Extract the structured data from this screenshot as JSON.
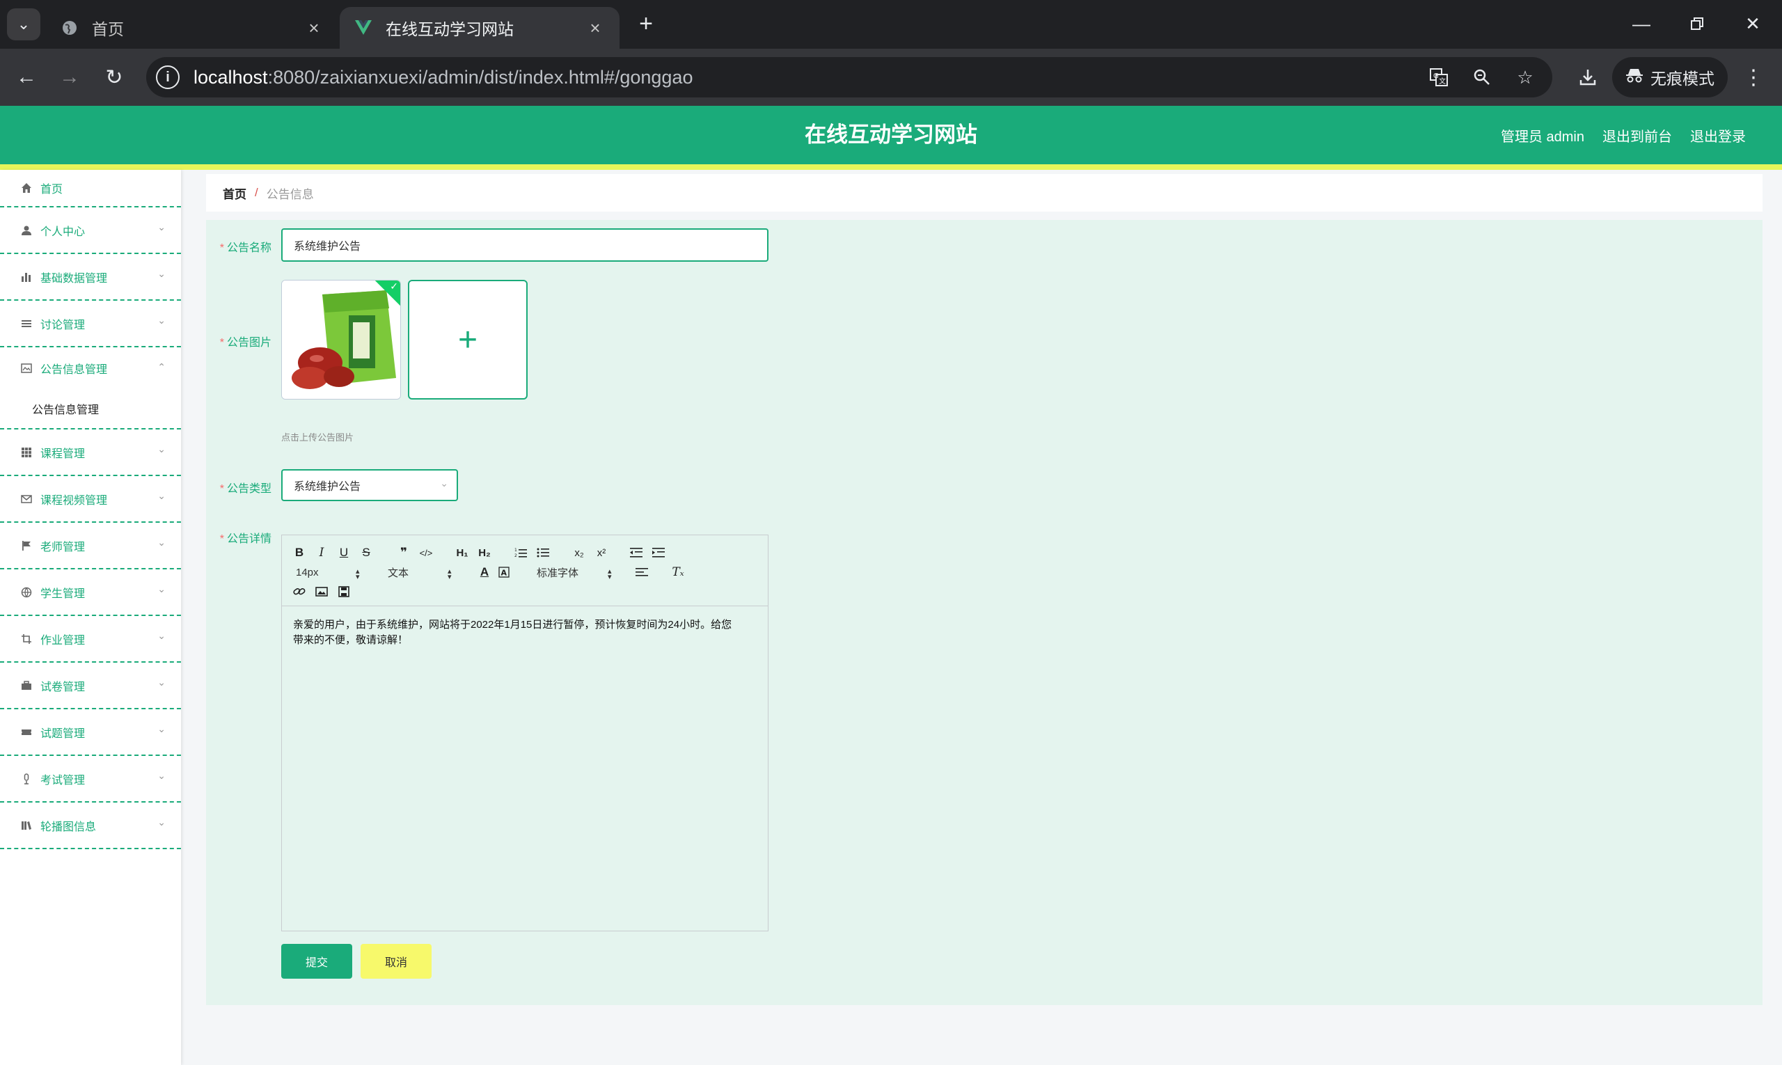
{
  "browser": {
    "tabs": [
      {
        "title": "首页",
        "favicon": "globe-icon"
      },
      {
        "title": "在线互动学习网站",
        "favicon": "vue-logo-icon"
      }
    ],
    "url_host": "localhost",
    "url_rest": ":8080/zaixianxuexi/admin/dist/index.html#/gonggao",
    "incognito_label": "无痕模式"
  },
  "header": {
    "title": "在线互动学习网站",
    "user_label": "管理员 admin",
    "to_front": "退出到前台",
    "logout": "退出登录",
    "accent_color": "#1aab7a",
    "bar_color": "#e6f55a"
  },
  "sidebar": {
    "items": [
      {
        "label": "首页",
        "icon": "home-icon"
      },
      {
        "label": "个人中心",
        "icon": "user-icon"
      },
      {
        "label": "基础数据管理",
        "icon": "bar-chart-icon"
      },
      {
        "label": "讨论管理",
        "icon": "list-icon"
      },
      {
        "label": "公告信息管理",
        "icon": "notice-icon"
      },
      {
        "label": "公告信息管理",
        "icon": ""
      },
      {
        "label": "课程管理",
        "icon": "grid-icon"
      },
      {
        "label": "课程视频管理",
        "icon": "mail-icon"
      },
      {
        "label": "老师管理",
        "icon": "flag-icon"
      },
      {
        "label": "学生管理",
        "icon": "globe-icon"
      },
      {
        "label": "作业管理",
        "icon": "crop-icon"
      },
      {
        "label": "试卷管理",
        "icon": "briefcase-icon"
      },
      {
        "label": "试题管理",
        "icon": "ticket-icon"
      },
      {
        "label": "考试管理",
        "icon": "mic-icon"
      },
      {
        "label": "轮播图信息",
        "icon": "library-icon"
      }
    ]
  },
  "breadcrumb": {
    "home": "首页",
    "separator": "/",
    "current": "公告信息"
  },
  "form": {
    "name_label": "公告名称",
    "name_value": "系统维护公告",
    "image_label": "公告图片",
    "image_hint": "点击上传公告图片",
    "type_label": "公告类型",
    "type_value": "系统维护公告",
    "detail_label": "公告详情",
    "editor": {
      "font_size": "14px",
      "header": "文本",
      "font_family": "标准字体",
      "content": "亲爱的用户，由于系统维护，网站将于2022年1月15日进行暂停，预计恢复时间为24小时。给您带来的不便，敬请谅解！"
    },
    "submit": "提交",
    "cancel": "取消"
  }
}
